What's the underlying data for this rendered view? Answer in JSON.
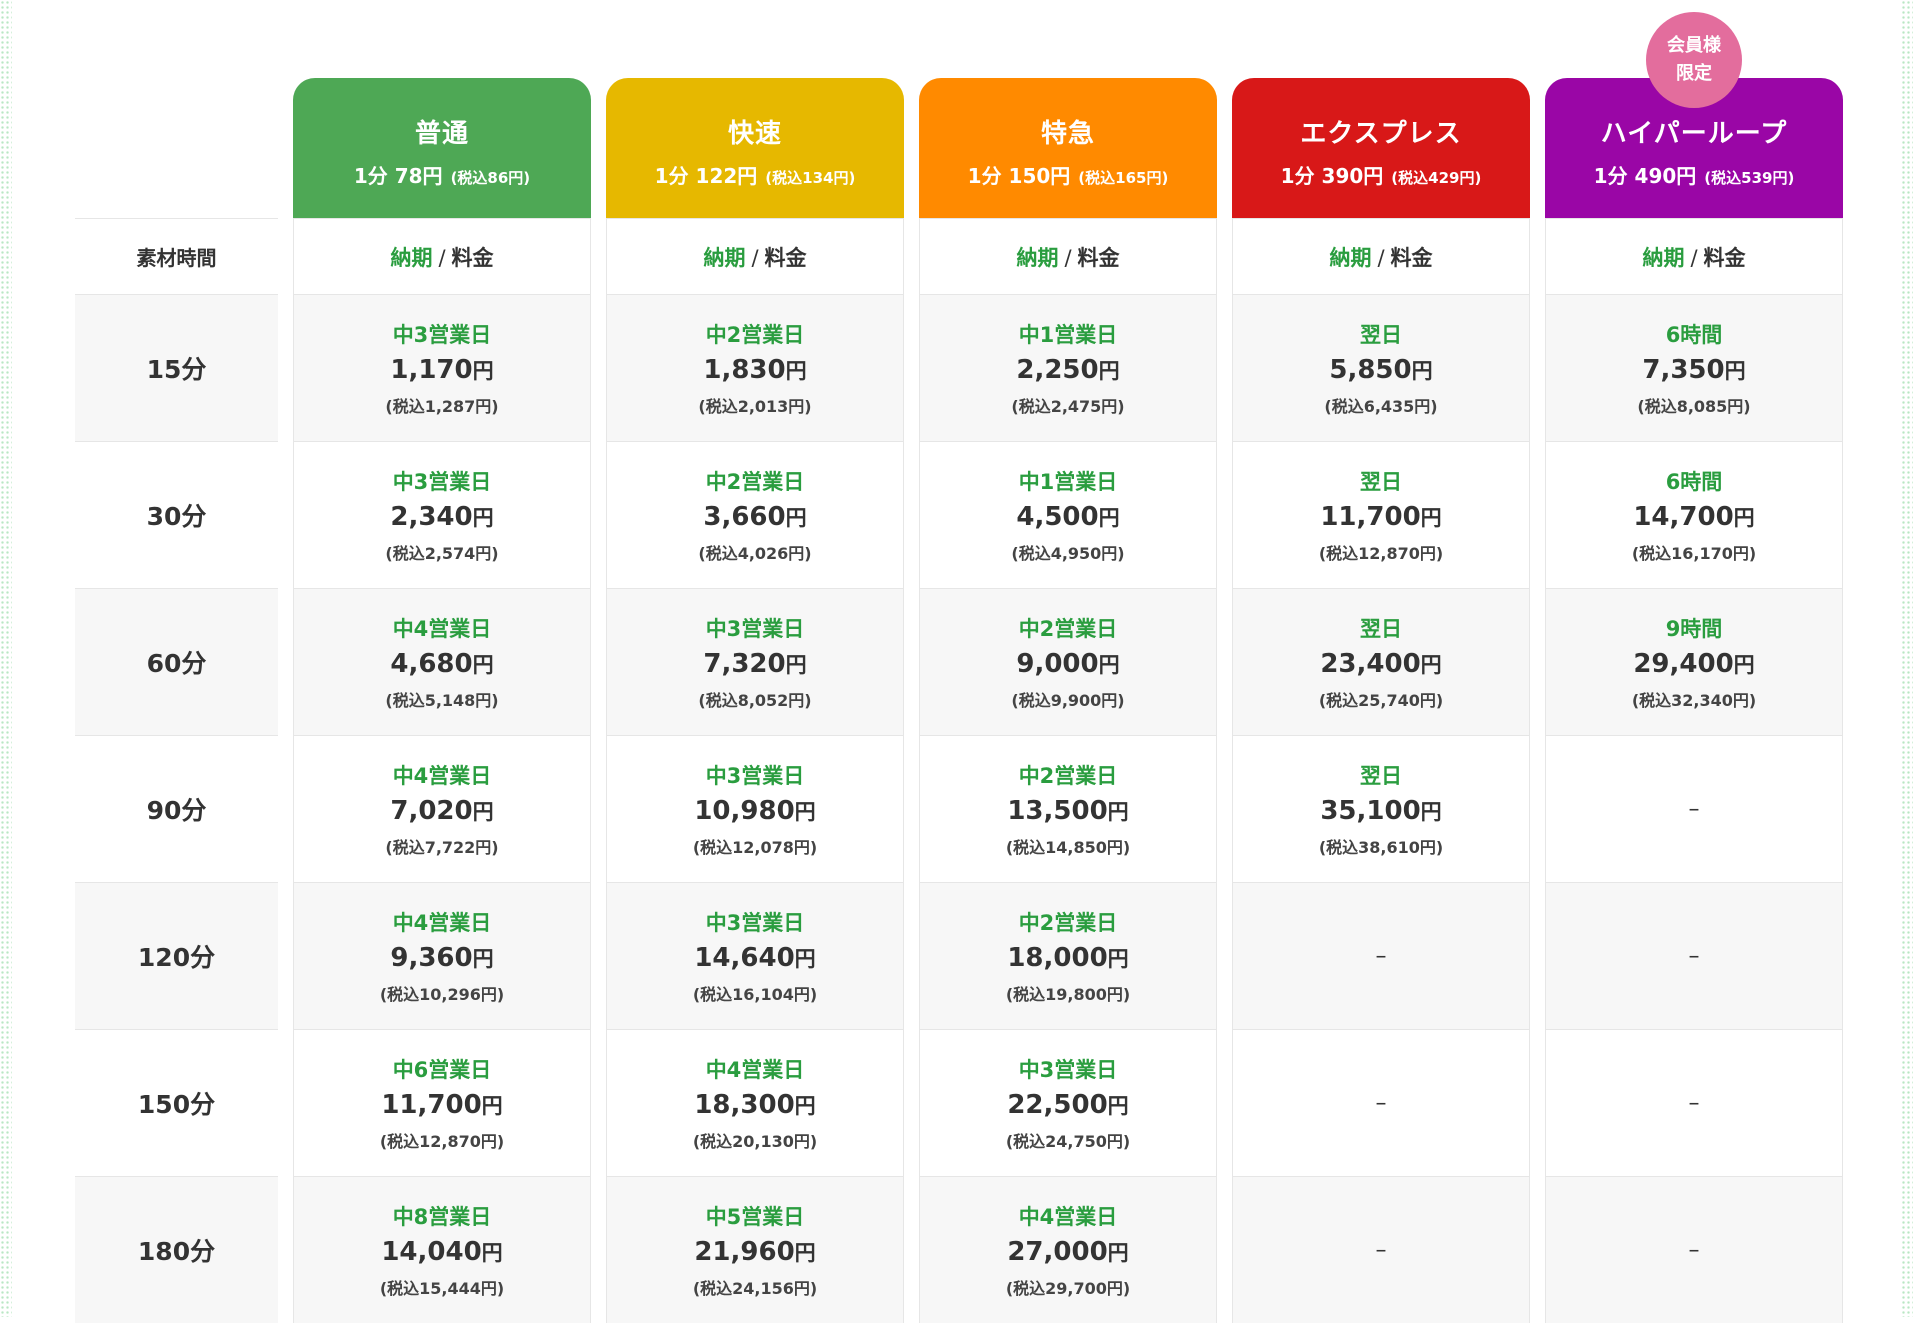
{
  "row_label_header": "素材時間",
  "subheader": {
    "delivery": "納期",
    "separator": "/",
    "price": "料金"
  },
  "plans": [
    {
      "name": "普通",
      "rate": "1分 78円",
      "tax_rate": "(税込86円)",
      "color": "#4ea855",
      "badge": null
    },
    {
      "name": "快速",
      "rate": "1分 122円",
      "tax_rate": "(税込134円)",
      "color": "#e6b800",
      "badge": null
    },
    {
      "name": "特急",
      "rate": "1分 150円",
      "tax_rate": "(税込165円)",
      "color": "#ff8a00",
      "badge": null
    },
    {
      "name": "エクスプレス",
      "rate": "1分 390円",
      "tax_rate": "(税込429円)",
      "color": "#d81818",
      "badge": null
    },
    {
      "name": "ハイパーループ",
      "rate": "1分 490円",
      "tax_rate": "(税込539円)",
      "color": "#9a06a6",
      "badge": [
        "会員様",
        "限定"
      ]
    }
  ],
  "rows": [
    {
      "duration": "15分",
      "cells": [
        {
          "delivery": "中3営業日",
          "price": "1,170",
          "yen": "円",
          "taxed": "(税込1,287円)"
        },
        {
          "delivery": "中2営業日",
          "price": "1,830",
          "yen": "円",
          "taxed": "(税込2,013円)"
        },
        {
          "delivery": "中1営業日",
          "price": "2,250",
          "yen": "円",
          "taxed": "(税込2,475円)"
        },
        {
          "delivery": "翌日",
          "price": "5,850",
          "yen": "円",
          "taxed": "(税込6,435円)"
        },
        {
          "delivery": "6時間",
          "price": "7,350",
          "yen": "円",
          "taxed": "(税込8,085円)"
        }
      ]
    },
    {
      "duration": "30分",
      "cells": [
        {
          "delivery": "中3営業日",
          "price": "2,340",
          "yen": "円",
          "taxed": "(税込2,574円)"
        },
        {
          "delivery": "中2営業日",
          "price": "3,660",
          "yen": "円",
          "taxed": "(税込4,026円)"
        },
        {
          "delivery": "中1営業日",
          "price": "4,500",
          "yen": "円",
          "taxed": "(税込4,950円)"
        },
        {
          "delivery": "翌日",
          "price": "11,700",
          "yen": "円",
          "taxed": "(税込12,870円)"
        },
        {
          "delivery": "6時間",
          "price": "14,700",
          "yen": "円",
          "taxed": "(税込16,170円)"
        }
      ]
    },
    {
      "duration": "60分",
      "cells": [
        {
          "delivery": "中4営業日",
          "price": "4,680",
          "yen": "円",
          "taxed": "(税込5,148円)"
        },
        {
          "delivery": "中3営業日",
          "price": "7,320",
          "yen": "円",
          "taxed": "(税込8,052円)"
        },
        {
          "delivery": "中2営業日",
          "price": "9,000",
          "yen": "円",
          "taxed": "(税込9,900円)"
        },
        {
          "delivery": "翌日",
          "price": "23,400",
          "yen": "円",
          "taxed": "(税込25,740円)"
        },
        {
          "delivery": "9時間",
          "price": "29,400",
          "yen": "円",
          "taxed": "(税込32,340円)"
        }
      ]
    },
    {
      "duration": "90分",
      "cells": [
        {
          "delivery": "中4営業日",
          "price": "7,020",
          "yen": "円",
          "taxed": "(税込7,722円)"
        },
        {
          "delivery": "中3営業日",
          "price": "10,980",
          "yen": "円",
          "taxed": "(税込12,078円)"
        },
        {
          "delivery": "中2営業日",
          "price": "13,500",
          "yen": "円",
          "taxed": "(税込14,850円)"
        },
        {
          "delivery": "翌日",
          "price": "35,100",
          "yen": "円",
          "taxed": "(税込38,610円)"
        },
        null
      ]
    },
    {
      "duration": "120分",
      "cells": [
        {
          "delivery": "中4営業日",
          "price": "9,360",
          "yen": "円",
          "taxed": "(税込10,296円)"
        },
        {
          "delivery": "中3営業日",
          "price": "14,640",
          "yen": "円",
          "taxed": "(税込16,104円)"
        },
        {
          "delivery": "中2営業日",
          "price": "18,000",
          "yen": "円",
          "taxed": "(税込19,800円)"
        },
        null,
        null
      ]
    },
    {
      "duration": "150分",
      "cells": [
        {
          "delivery": "中6営業日",
          "price": "11,700",
          "yen": "円",
          "taxed": "(税込12,870円)"
        },
        {
          "delivery": "中4営業日",
          "price": "18,300",
          "yen": "円",
          "taxed": "(税込20,130円)"
        },
        {
          "delivery": "中3営業日",
          "price": "22,500",
          "yen": "円",
          "taxed": "(税込24,750円)"
        },
        null,
        null
      ]
    },
    {
      "duration": "180分",
      "cells": [
        {
          "delivery": "中8営業日",
          "price": "14,040",
          "yen": "円",
          "taxed": "(税込15,444円)"
        },
        {
          "delivery": "中5営業日",
          "price": "21,960",
          "yen": "円",
          "taxed": "(税込24,156円)"
        },
        {
          "delivery": "中4営業日",
          "price": "27,000",
          "yen": "円",
          "taxed": "(税込29,700円)"
        },
        null,
        null
      ]
    }
  ],
  "empty_cell": "–"
}
